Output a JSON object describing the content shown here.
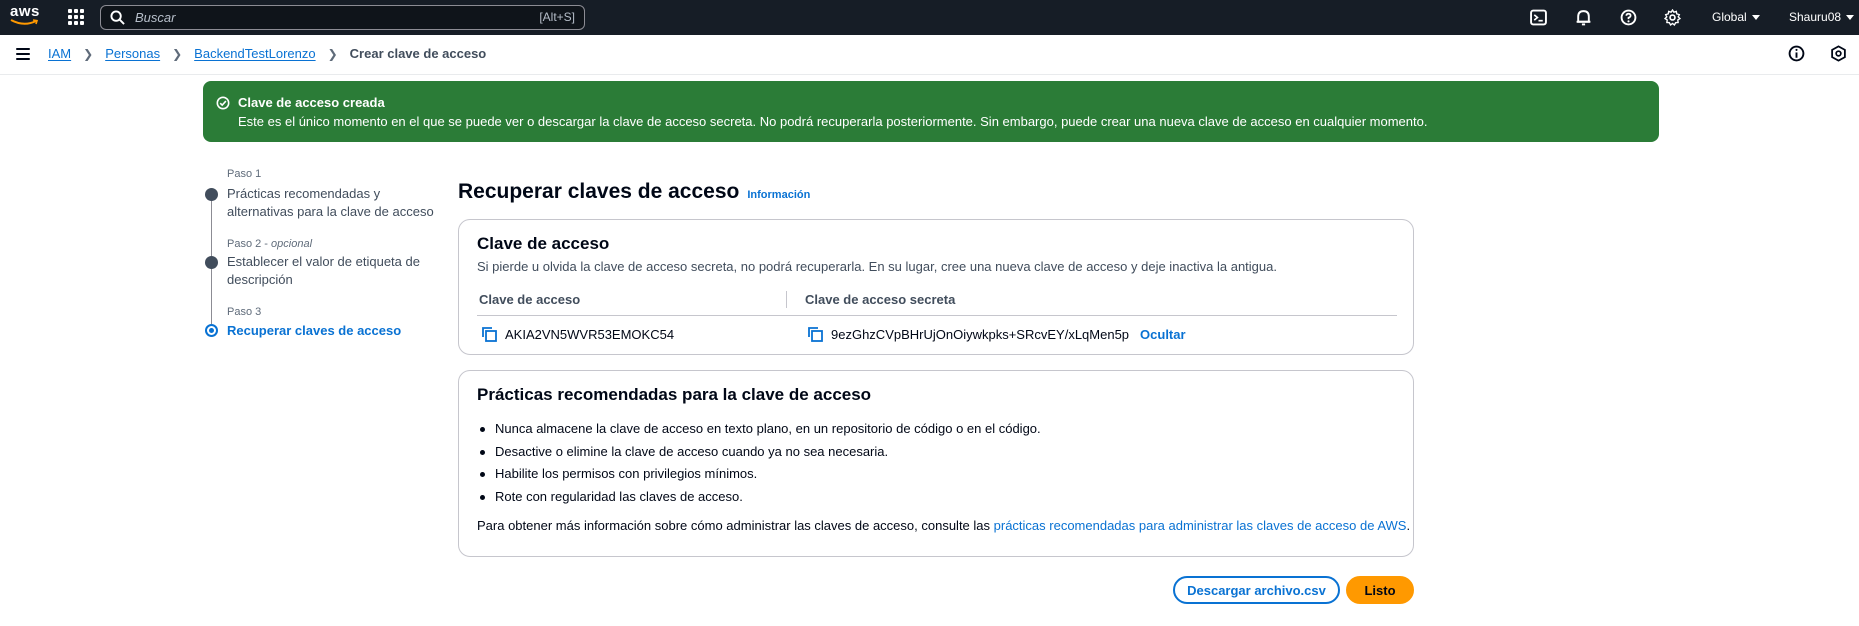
{
  "topnav": {
    "logo_text": "aws",
    "search_placeholder": "Buscar",
    "search_shortcut": "[Alt+S]",
    "region_label": "Global",
    "user_label": "Shauru08",
    "icons": [
      "terminal-icon",
      "bell-icon",
      "help-icon",
      "gear-icon"
    ]
  },
  "breadcrumb": {
    "items": [
      "IAM",
      "Personas",
      "BackendTestLorenzo"
    ],
    "current": "Crear clave de acceso",
    "separator": ">"
  },
  "flash": {
    "type": "success",
    "title": "Clave de acceso creada",
    "message": "Este es el único momento en el que se puede ver o descargar la clave de acceso secreta. No podrá recuperarla posteriormente. Sin embargo, puede crear una nueva clave de acceso en cualquier momento.",
    "color": "#2b7c37"
  },
  "steps": [
    {
      "step_label": "Paso 1",
      "optional": "",
      "title": "Prácticas recomendadas y alternativas para la clave de acceso",
      "state": "done"
    },
    {
      "step_label": "Paso 2",
      "optional": "opcional",
      "title": "Establecer el valor de etiqueta de descripción",
      "state": "done"
    },
    {
      "step_label": "Paso 3",
      "optional": "",
      "title": "Recuperar claves de acceso",
      "state": "current"
    }
  ],
  "main": {
    "title": "Recuperar claves de acceso",
    "info_link": "Información",
    "access_key_card": {
      "title": "Clave de acceso",
      "description": "Si pierde u olvida la clave de acceso secreta, no podrá recuperarla. En su lugar, cree una nueva clave de acceso y deje inactiva la antigua.",
      "col_access_key": "Clave de acceso",
      "col_secret_key": "Clave de acceso secreta",
      "access_key_value": "AKIA2VN5WVR53EMOKC54",
      "secret_key_value": "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",
      "hide_label": "Ocultar"
    },
    "best_practices_card": {
      "title": "Prácticas recomendadas para la clave de acceso",
      "items": [
        "Nunca almacene la clave de acceso en texto plano, en un repositorio de código o en el código.",
        "Desactive o elimine la clave de acceso cuando ya no sea necesaria.",
        "Habilite los permisos con privilegios mínimos.",
        "Rote con regularidad las claves de acceso."
      ],
      "footer_prefix": "Para obtener más información sobre cómo administrar las claves de acceso, consulte las ",
      "footer_link": "prácticas recomendadas para administrar las claves de acceso de AWS",
      "footer_suffix": "."
    },
    "buttons": {
      "download_csv": "Descargar archivo.csv",
      "done": "Listo"
    }
  },
  "colors": {
    "nav_bg": "#161d26",
    "link": "#0972d3",
    "primary_button": "#ff9900",
    "success": "#2b7c37"
  }
}
